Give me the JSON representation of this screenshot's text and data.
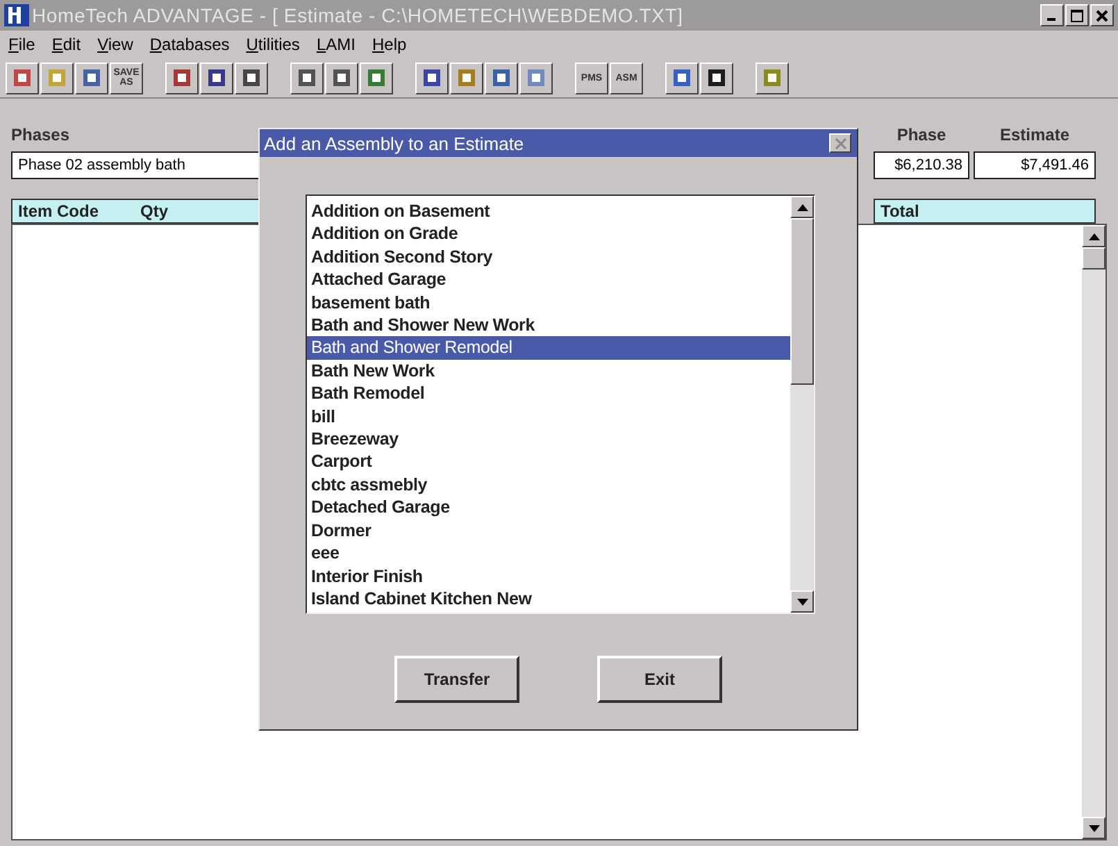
{
  "window": {
    "title": "HomeTech ADVANTAGE - [ Estimate - C:\\HOMETECH\\WEBDEMO.TXT]"
  },
  "menu": [
    "File",
    "Edit",
    "View",
    "Databases",
    "Utilities",
    "LAMI",
    "Help"
  ],
  "toolbar": [
    {
      "kind": "icon"
    },
    {
      "kind": "icon"
    },
    {
      "kind": "icon"
    },
    {
      "kind": "text",
      "label": "SAVE AS"
    },
    {
      "kind": "gap"
    },
    {
      "kind": "icon"
    },
    {
      "kind": "icon"
    },
    {
      "kind": "icon"
    },
    {
      "kind": "gap"
    },
    {
      "kind": "icon"
    },
    {
      "kind": "icon"
    },
    {
      "kind": "icon"
    },
    {
      "kind": "gap"
    },
    {
      "kind": "icon"
    },
    {
      "kind": "icon"
    },
    {
      "kind": "icon"
    },
    {
      "kind": "icon"
    },
    {
      "kind": "gap"
    },
    {
      "kind": "text",
      "label": "PMS"
    },
    {
      "kind": "text",
      "label": "ASM"
    },
    {
      "kind": "gap"
    },
    {
      "kind": "icon"
    },
    {
      "kind": "icon"
    },
    {
      "kind": "gap"
    },
    {
      "kind": "icon"
    }
  ],
  "phases": {
    "label": "Phases",
    "value": "Phase 02 assembly bath"
  },
  "totals": [
    {
      "label": "Phase",
      "value": "$6,210.38"
    },
    {
      "label": "Estimate",
      "value": "$7,491.46"
    }
  ],
  "table": {
    "columns": [
      "Item Code",
      "Qty"
    ],
    "right_column": "Total"
  },
  "dialog": {
    "title": "Add an Assembly to an Estimate",
    "items": [
      {
        "label": "Addition on Basement",
        "selected": false
      },
      {
        "label": "Addition on Grade",
        "selected": false
      },
      {
        "label": "Addition Second Story",
        "selected": false
      },
      {
        "label": "Attached Garage",
        "selected": false
      },
      {
        "label": "basement bath",
        "selected": false
      },
      {
        "label": "Bath and Shower New Work",
        "selected": false
      },
      {
        "label": "Bath and Shower Remodel",
        "selected": true
      },
      {
        "label": "Bath New Work",
        "selected": false
      },
      {
        "label": "Bath Remodel",
        "selected": false
      },
      {
        "label": "bill",
        "selected": false
      },
      {
        "label": "Breezeway",
        "selected": false
      },
      {
        "label": "Carport",
        "selected": false
      },
      {
        "label": "cbtc assmebly",
        "selected": false
      },
      {
        "label": "Detached Garage",
        "selected": false
      },
      {
        "label": "Dormer",
        "selected": false
      },
      {
        "label": "eee",
        "selected": false
      },
      {
        "label": "Interior Finish",
        "selected": false
      },
      {
        "label": "Island Cabinet Kitchen New",
        "selected": false
      }
    ],
    "buttons": [
      "Transfer",
      "Exit"
    ]
  }
}
